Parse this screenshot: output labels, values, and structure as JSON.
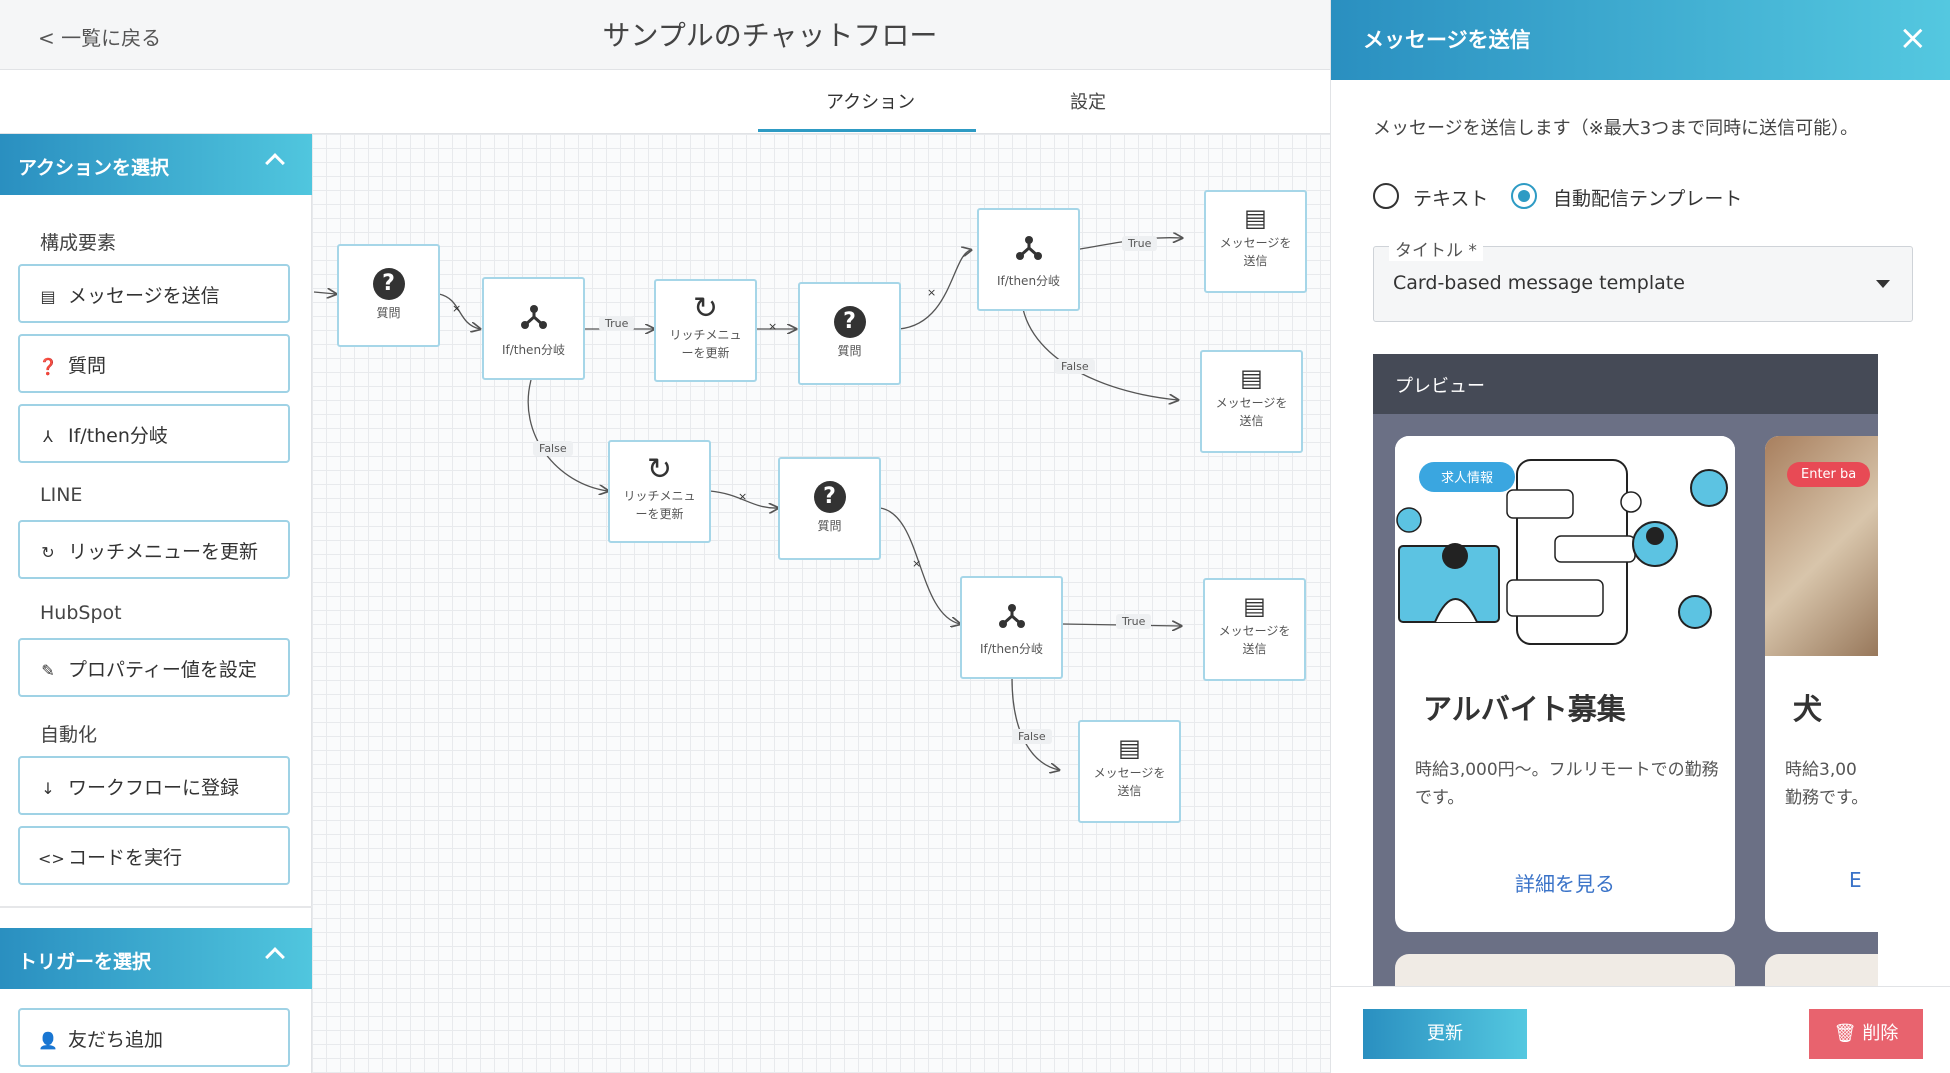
{
  "header": {
    "back_label": "< 一覧に戻る",
    "title": "サンプルのチャットフロー"
  },
  "tabs": [
    {
      "label": "アクション"
    },
    {
      "label": "設定"
    }
  ],
  "sidebar": {
    "actions_header": "アクションを選択",
    "groups": {
      "components": "構成要素",
      "line": "LINE",
      "hubspot": "HubSpot",
      "automation": "自動化"
    },
    "items": {
      "send_message": "メッセージを送信",
      "question": "質問",
      "ifthen": "If/then分岐",
      "rich_menu": "リッチメニューを更新",
      "set_property": "プロパティー値を設定",
      "enroll_workflow": "ワークフローに登録",
      "run_code": "コードを実行"
    },
    "triggers_header": "トリガーを選択",
    "add_friend": "友だち追加"
  },
  "canvas": {
    "labels": {
      "question": "質問",
      "ifthen": "If/then分岐",
      "rich_menu_1": "リッチメニュ",
      "rich_menu_2": "ーを更新",
      "send_1": "メッセージを",
      "send_2": "送信",
      "true": "True",
      "false": "False",
      "x": "×"
    }
  },
  "panel": {
    "title": "メッセージを送信",
    "close": "×",
    "description": "メッセージを送信します（※最大3つまで同時に送信可能）。",
    "radio_text": "テキスト",
    "radio_template": "自動配信テンプレート",
    "title_field_label": "タイトル *",
    "title_field_value": "Card-based message template",
    "preview_label": "プレビュー",
    "card1": {
      "badge": "求人情報",
      "title": "アルバイト募集",
      "body": "時給3,000円〜。フルリモートでの勤務です。",
      "link": "詳細を見る"
    },
    "card2": {
      "badge": "Enter ba",
      "title": "犬",
      "body_1": "時給3,00",
      "body_2": "勤務です。",
      "link": "E"
    },
    "update_button": "更新",
    "delete_button": "削除"
  },
  "colors": {
    "accent": "#2e9bc4",
    "danger": "#e8636e",
    "node_border": "#a6d6e8"
  }
}
